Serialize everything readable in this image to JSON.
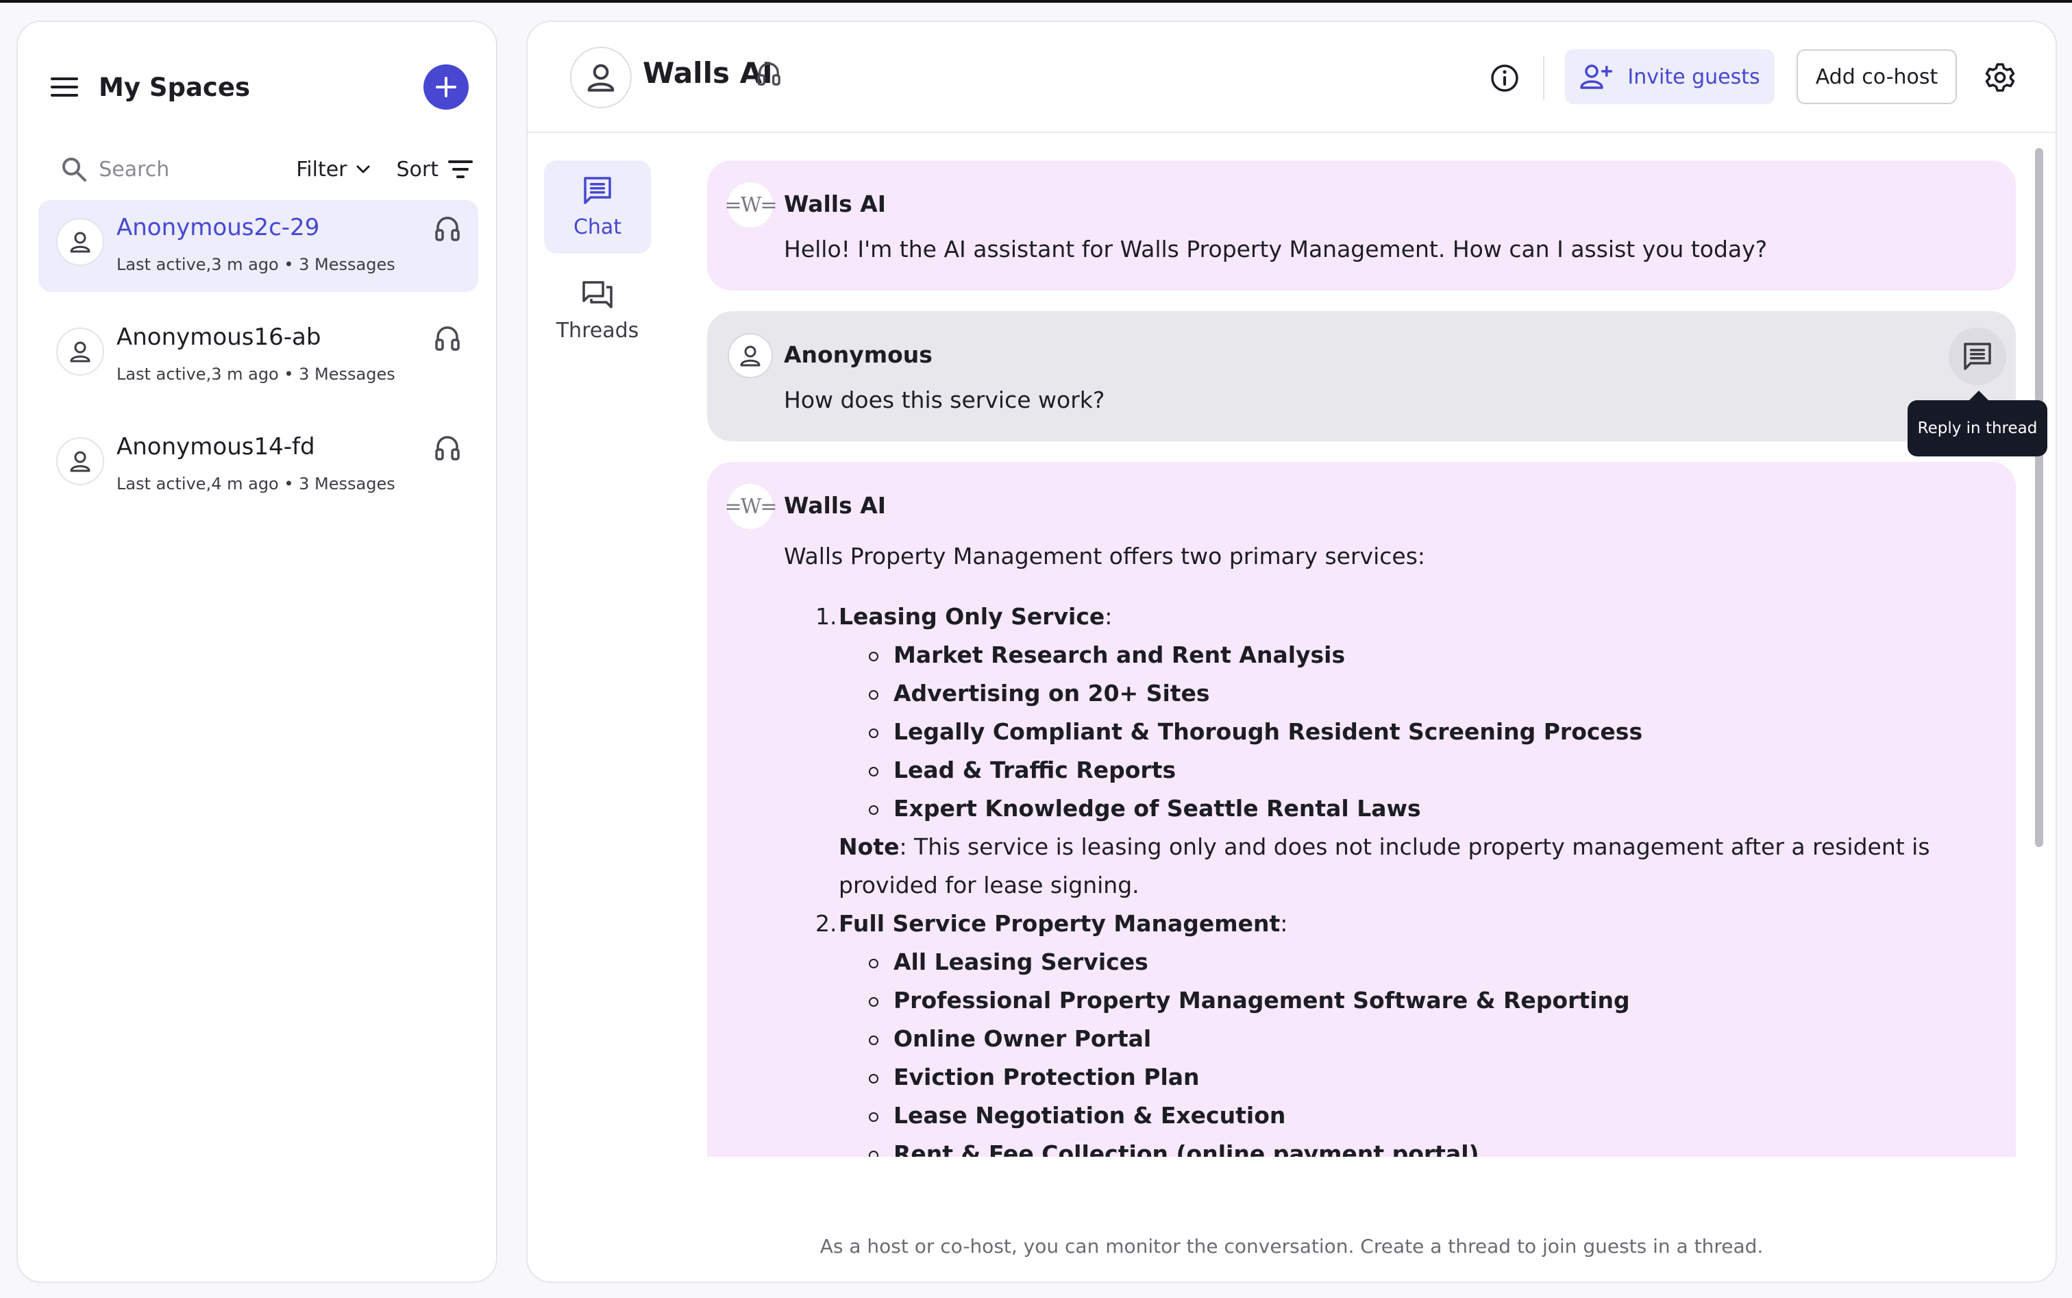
{
  "sidebar": {
    "title": "My Spaces",
    "search_placeholder": "Search",
    "filter_label": "Filter",
    "sort_label": "Sort",
    "conversations": [
      {
        "name": "Anonymous2c-29",
        "meta": "Last active,3 m ago • 3 Messages",
        "active": true
      },
      {
        "name": "Anonymous16-ab",
        "meta": "Last active,3 m ago • 3 Messages",
        "active": false
      },
      {
        "name": "Anonymous14-fd",
        "meta": "Last active,4 m ago • 3 Messages",
        "active": false
      }
    ]
  },
  "header": {
    "title": "Walls AI",
    "invite_label": "Invite guests",
    "cohost_label": "Add co-host"
  },
  "nav": {
    "chat_label": "Chat",
    "threads_label": "Threads"
  },
  "messages": {
    "m1": {
      "sender": "Walls AI",
      "avatar_text": "=W=",
      "text": "Hello! I'm the AI assistant for Walls Property Management. How can I assist you today?"
    },
    "m2": {
      "sender": "Anonymous",
      "text": "How does this service work?"
    },
    "m3": {
      "sender": "Walls AI",
      "avatar_text": "=W=",
      "intro": "Walls Property Management offers two primary services:",
      "services": [
        {
          "num": "1.",
          "title": "Leasing Only Service",
          "items": [
            "Market Research and Rent Analysis",
            "Advertising on 20+ Sites",
            "Legally Compliant & Thorough Resident Screening Process",
            "Lead & Traffic Reports",
            "Expert Knowledge of Seattle Rental Laws"
          ],
          "note_label": "Note",
          "note_text": ": This service is leasing only and does not include property management after a resident is provided for lease signing."
        },
        {
          "num": "2.",
          "title": "Full Service Property Management",
          "items": [
            "All Leasing Services",
            "Professional Property Management Software & Reporting",
            "Online Owner Portal",
            "Eviction Protection Plan",
            "Lease Negotiation & Execution",
            "Rent & Fee Collection (online payment portal)"
          ]
        }
      ]
    }
  },
  "tooltip": "Reply in thread",
  "footer": "As a host or co-host, you can monitor the conversation. Create a thread to join guests in a thread.",
  "colors": {
    "accent": "#4747d1",
    "accent_soft": "#ededfc",
    "ai_bubble": "#f8e8fb",
    "user_bubble": "#e8e8ec",
    "tooltip_bg": "#161a27"
  },
  "icons": [
    "menu-icon",
    "plus-icon",
    "search-icon",
    "chevron-down-icon",
    "sort-icon",
    "person-icon",
    "headset-icon",
    "info-icon",
    "add-person-icon",
    "gear-icon",
    "chat-icon",
    "threads-icon",
    "reply-thread-icon"
  ]
}
